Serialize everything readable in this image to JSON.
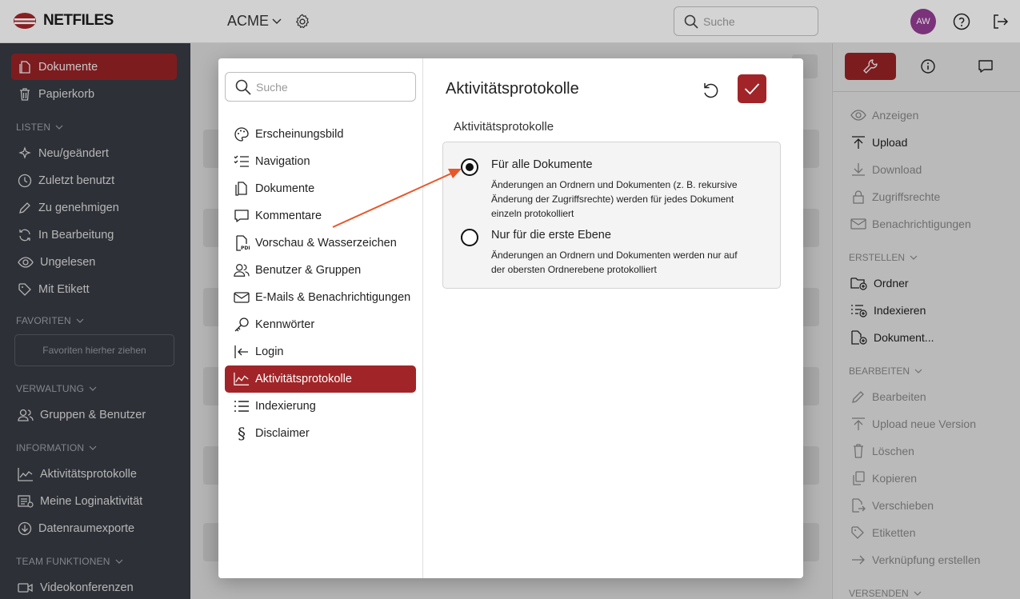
{
  "topbar": {
    "brand": "NETFILES",
    "org": "ACME",
    "search_placeholder": "Suche",
    "avatar_initials": "AW"
  },
  "sidebar": {
    "items_top": [
      {
        "label": "Dokumente",
        "icon": "document-icon",
        "active": true
      },
      {
        "label": "Papierkorb",
        "icon": "trash-icon"
      }
    ],
    "section_listen": "LISTEN",
    "items_listen": [
      {
        "label": "Neu/geändert",
        "icon": "sparkle-icon"
      },
      {
        "label": "Zuletzt benutzt",
        "icon": "clock-icon"
      },
      {
        "label": "Zu genehmigen",
        "icon": "pencil-icon"
      },
      {
        "label": "In Bearbeitung",
        "icon": "refresh-icon"
      },
      {
        "label": "Ungelesen",
        "icon": "eye-icon"
      },
      {
        "label": "Mit Etikett",
        "icon": "tag-icon"
      }
    ],
    "section_favoriten": "FAVORITEN",
    "favorites_drop": "Favoriten hierher ziehen",
    "section_verwaltung": "VERWALTUNG",
    "items_verwaltung": [
      {
        "label": "Gruppen & Benutzer",
        "icon": "users-icon"
      }
    ],
    "section_information": "INFORMATION",
    "items_information": [
      {
        "label": "Aktivitätsprotokolle",
        "icon": "chart-icon"
      },
      {
        "label": "Meine Loginaktivität",
        "icon": "list-icon"
      },
      {
        "label": "Datenraumexporte",
        "icon": "download-circle-icon"
      }
    ],
    "section_team": "TEAM FUNKTIONEN",
    "items_team": [
      {
        "label": "Videokonferenzen",
        "icon": "video-icon"
      }
    ]
  },
  "right_panel": {
    "items_main": [
      {
        "label": "Anzeigen",
        "enabled": false
      },
      {
        "label": "Upload",
        "enabled": true
      },
      {
        "label": "Download",
        "enabled": false
      },
      {
        "label": "Zugriffsrechte",
        "enabled": false
      },
      {
        "label": "Benachrichtigungen",
        "enabled": false
      }
    ],
    "section_erstellen": "ERSTELLEN",
    "items_erstellen": [
      {
        "label": "Ordner",
        "enabled": true
      },
      {
        "label": "Indexieren",
        "enabled": true
      },
      {
        "label": "Dokument...",
        "enabled": true
      }
    ],
    "section_bearbeiten": "BEARBEITEN",
    "items_bearbeiten": [
      {
        "label": "Bearbeiten",
        "enabled": false
      },
      {
        "label": "Upload neue Version",
        "enabled": false
      },
      {
        "label": "Löschen",
        "enabled": false
      },
      {
        "label": "Kopieren",
        "enabled": false
      },
      {
        "label": "Verschieben",
        "enabled": false
      },
      {
        "label": "Etiketten",
        "enabled": false
      },
      {
        "label": "Verknüpfung erstellen",
        "enabled": false
      }
    ],
    "section_versenden": "VERSENDEN"
  },
  "modal": {
    "search_placeholder": "Suche",
    "nav": [
      {
        "label": "Erscheinungsbild",
        "icon": "palette-icon"
      },
      {
        "label": "Navigation",
        "icon": "checklist-icon"
      },
      {
        "label": "Dokumente",
        "icon": "document-icon"
      },
      {
        "label": "Kommentare",
        "icon": "comment-icon"
      },
      {
        "label": "Vorschau & Wasserzeichen",
        "icon": "pdf-icon"
      },
      {
        "label": "Benutzer & Gruppen",
        "icon": "users-icon"
      },
      {
        "label": "E-Mails & Benachrichtigungen",
        "icon": "mail-icon"
      },
      {
        "label": "Kennwörter",
        "icon": "key-icon"
      },
      {
        "label": "Login",
        "icon": "login-icon"
      },
      {
        "label": "Aktivitätsprotokolle",
        "icon": "chart-icon",
        "active": true
      },
      {
        "label": "Indexierung",
        "icon": "list-icon"
      },
      {
        "label": "Disclaimer",
        "icon": "paragraph-icon"
      }
    ],
    "title": "Aktivitätsprotokolle",
    "subtitle": "Aktivitätsprotokolle",
    "options": [
      {
        "label": "Für alle Dokumente",
        "description": "Änderungen an Ordnern und Dokumenten (z. B. rekursive Änderung der Zugriffsrechte) werden für jedes Dokument einzeln protokolliert",
        "selected": true
      },
      {
        "label": "Nur für die erste Ebene",
        "description": "Änderungen an Ordnern und Dokumenten werden nur auf der obersten Ordnerebene protokolliert",
        "selected": false
      }
    ]
  },
  "colors": {
    "accent": "#a12528",
    "sidebar_bg": "#3a3e47",
    "annotation_arrow": "#e8562a"
  }
}
